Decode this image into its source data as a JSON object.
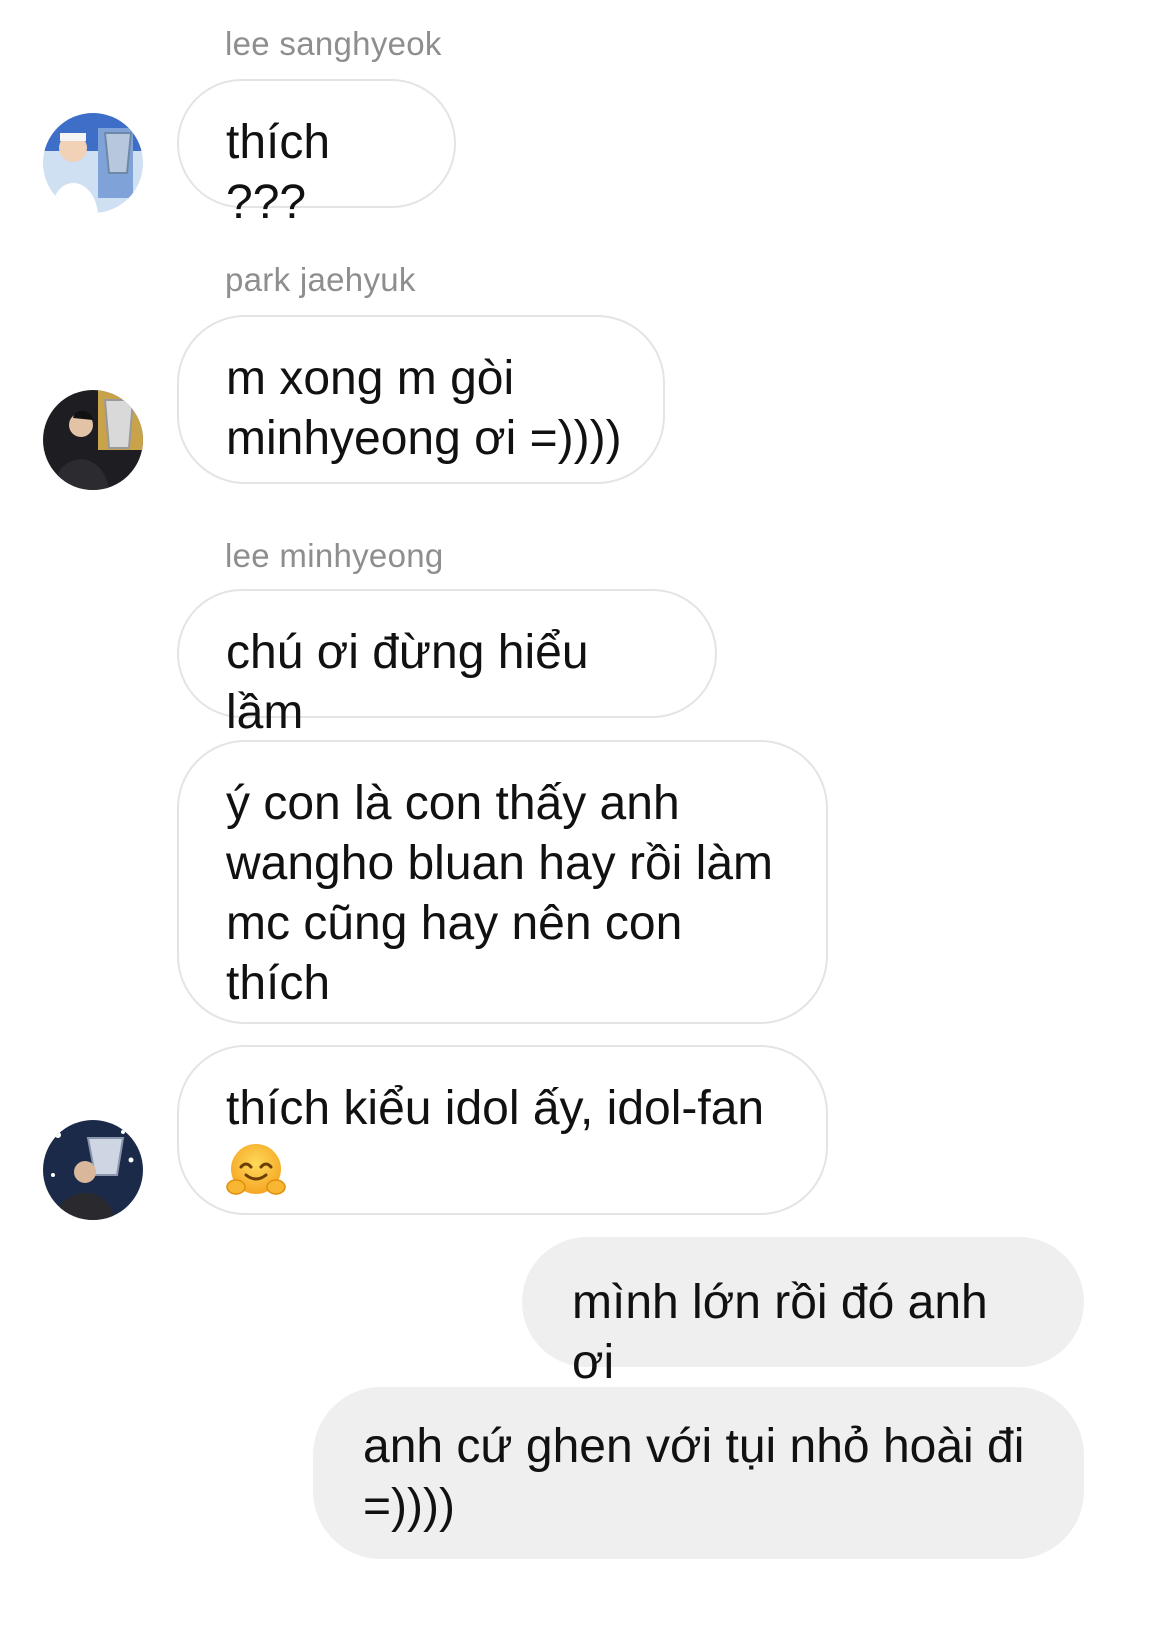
{
  "messages": [
    {
      "sender": "lee sanghyeok",
      "avatar": "user-avatar-photo",
      "bubbles": [
        "thích ???"
      ]
    },
    {
      "sender": "park jaehyuk",
      "avatar": "user-avatar-photo",
      "bubbles": [
        "m xong m gòi\nminhyeong ơi =))))"
      ]
    },
    {
      "sender": "lee minhyeong",
      "avatar": "user-avatar-photo",
      "bubbles": [
        "chú ơi đừng hiểu lầm",
        "ý con là con thấy anh\nwangho bluan hay rồi làm\nmc cũng hay nên con\nthích",
        "thích kiểu idol ấy, idol-fan"
      ],
      "emoji": "hugging-face-icon"
    }
  ],
  "outgoing": [
    "mình lớn rồi đó anh ơi",
    "anh cứ ghen với tụi nhỏ hoài đi\n=))))"
  ],
  "colors": {
    "incoming_bubble_border": "#e4e4e4",
    "outgoing_bubble_bg": "#efefef",
    "sender_name": "#8e8e8e",
    "text": "#111111"
  }
}
